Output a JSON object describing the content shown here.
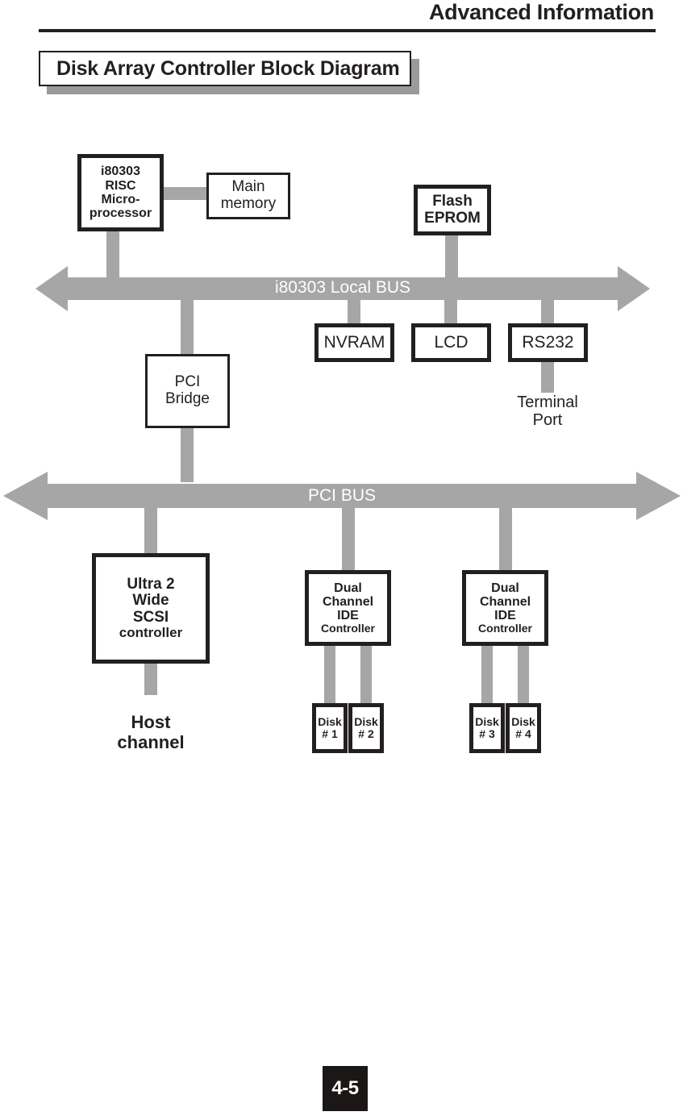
{
  "header": {
    "title": "Advanced Information"
  },
  "section": {
    "title": "Disk Array Controller Block Diagram"
  },
  "diagram": {
    "blocks": {
      "cpu": {
        "lines": [
          "i80303",
          "RISC",
          "Micro-",
          "processor"
        ]
      },
      "main_memory": {
        "lines": [
          "Main",
          "memory"
        ]
      },
      "flash_eprom": {
        "lines": [
          "Flash",
          "EPROM"
        ]
      },
      "nvram": {
        "label": "NVRAM"
      },
      "lcd": {
        "label": "LCD"
      },
      "rs232": {
        "label": "RS232"
      },
      "pci_bridge": {
        "lines": [
          "PCI",
          "Bridge"
        ]
      },
      "scsi_controller": {
        "lines": [
          "Ultra 2",
          "Wide",
          "SCSI",
          "controller"
        ]
      },
      "ide_controller_1": {
        "lines": [
          "Dual",
          "Channel",
          "IDE",
          "Controller"
        ]
      },
      "ide_controller_2": {
        "lines": [
          "Dual",
          "Channel",
          "IDE",
          "Controller"
        ]
      },
      "disk1": {
        "lines": [
          "Disk",
          "# 1"
        ]
      },
      "disk2": {
        "lines": [
          "Disk",
          "# 2"
        ]
      },
      "disk3": {
        "lines": [
          "Disk",
          "# 3"
        ]
      },
      "disk4": {
        "lines": [
          "Disk",
          "# 4"
        ]
      }
    },
    "buses": {
      "local_bus": {
        "label": "i80303 Local BUS"
      },
      "pci_bus": {
        "label": "PCI BUS"
      }
    },
    "labels": {
      "terminal_port": {
        "lines": [
          "Terminal",
          "Port"
        ]
      },
      "host_channel": {
        "lines": [
          "Host",
          "channel"
        ]
      }
    },
    "colors": {
      "bus_gray": "#a6a6a6",
      "line_black": "#231f1f",
      "shadow_gray": "#9b9b9b",
      "bus_text": "#ffffff"
    }
  },
  "footer": {
    "page_number": "4-5"
  }
}
